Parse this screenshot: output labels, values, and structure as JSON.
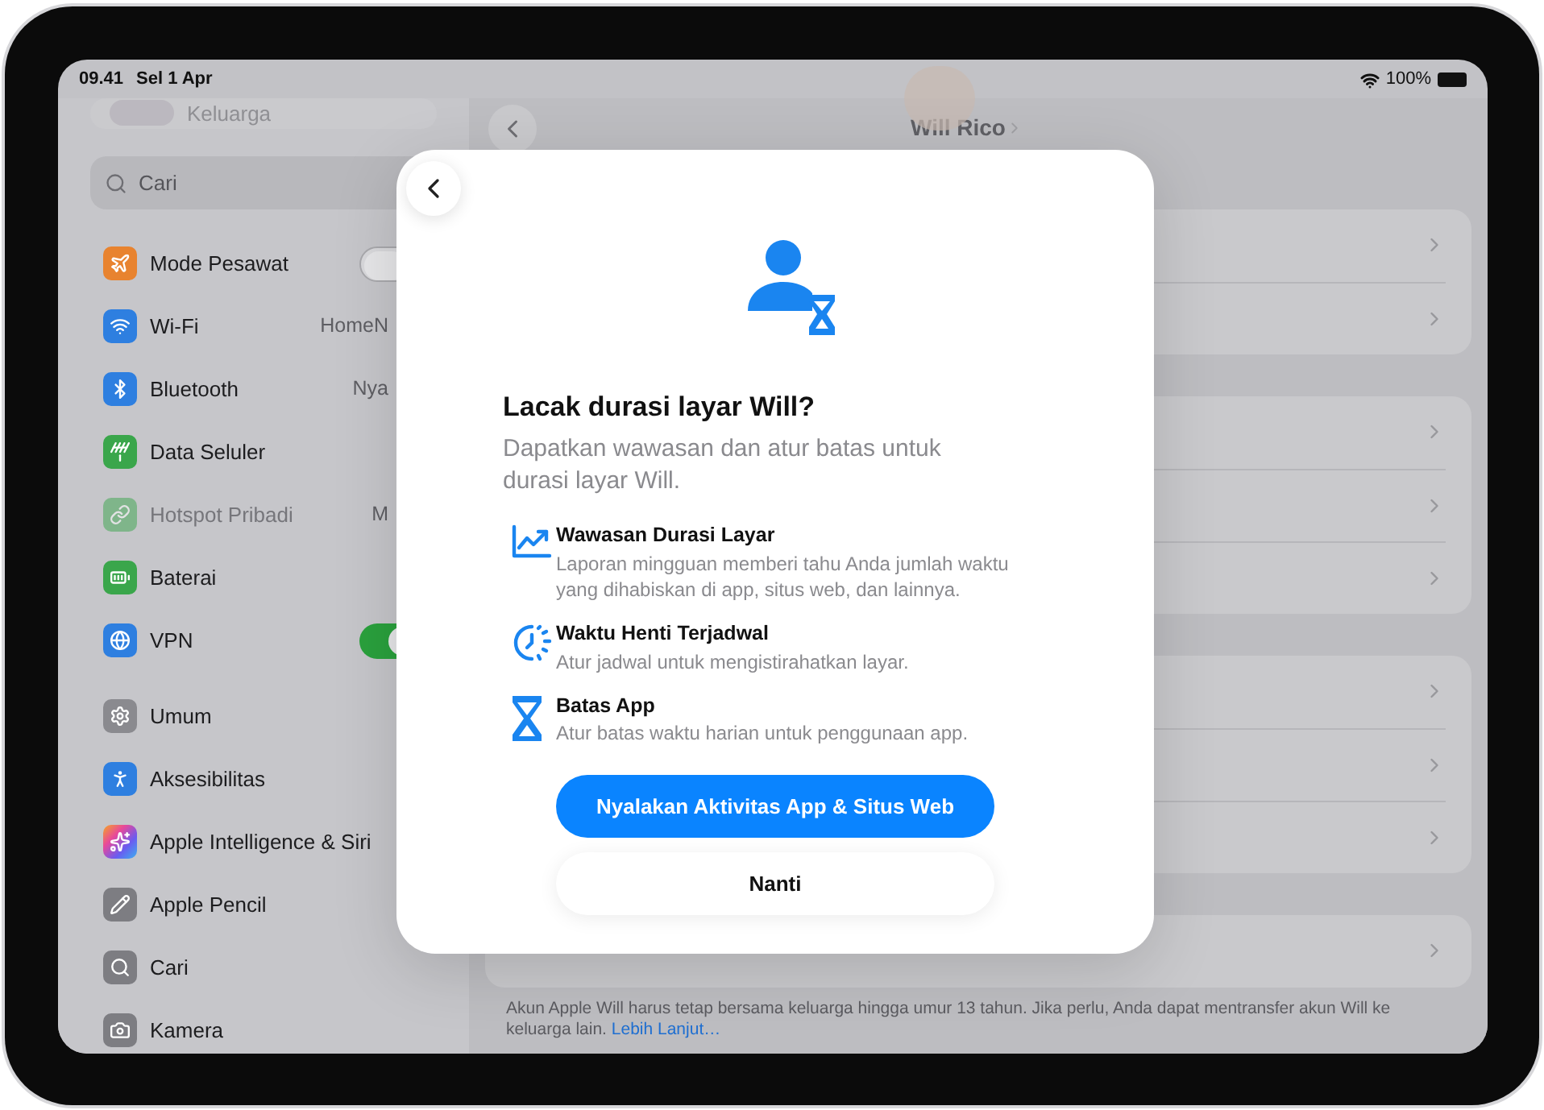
{
  "status_bar": {
    "time": "09.41",
    "date": "Sel 1 Apr",
    "battery": "100%"
  },
  "sidebar": {
    "family": "Keluarga",
    "search": {
      "placeholder": "Cari"
    },
    "groups": [
      [
        {
          "label": "Mode Pesawat",
          "kind": "toggle",
          "on": false,
          "disabled": false
        },
        {
          "label": "Wi-Fi",
          "kind": "value",
          "value": "HomeN",
          "disabled": false
        },
        {
          "label": "Bluetooth",
          "kind": "value",
          "value": "Nya",
          "disabled": false
        },
        {
          "label": "Data Seluler",
          "kind": "plain",
          "disabled": false
        },
        {
          "label": "Hotspot Pribadi",
          "kind": "value",
          "value": "M",
          "disabled": true
        },
        {
          "label": "Baterai",
          "kind": "plain",
          "disabled": false
        },
        {
          "label": "VPN",
          "kind": "toggle",
          "on": true,
          "disabled": false
        }
      ],
      [
        {
          "label": "Umum",
          "kind": "plain",
          "disabled": false
        },
        {
          "label": "Aksesibilitas",
          "kind": "plain",
          "disabled": false
        },
        {
          "label": "Apple Intelligence & Siri",
          "kind": "plain",
          "disabled": false
        },
        {
          "label": "Apple Pencil",
          "kind": "plain",
          "disabled": false
        },
        {
          "label": "Cari",
          "kind": "plain",
          "disabled": false
        },
        {
          "label": "Kamera",
          "kind": "plain",
          "disabled": false
        }
      ]
    ]
  },
  "detail": {
    "title": "Will Rico",
    "footer": "Akun Apple Will harus tetap bersama keluarga hingga umur 13 tahun. Jika perlu, Anda dapat mentransfer akun Will ke keluarga lain.",
    "footer_link": "Lebih Lanjut…"
  },
  "modal": {
    "title": "Lacak durasi layar Will?",
    "subtitle": "Dapatkan wawasan dan atur batas untuk durasi layar Will.",
    "features": [
      {
        "kind": "chart",
        "title": "Wawasan Durasi Layar",
        "text": "Laporan mingguan memberi tahu Anda jumlah waktu yang dihabiskan di app, situs web, dan lainnya."
      },
      {
        "kind": "downtime",
        "title": "Waktu Henti Terjadwal",
        "text": "Atur jadwal untuk mengistirahatkan layar."
      },
      {
        "kind": "limit",
        "title": "Batas App",
        "text": "Atur batas waktu harian untuk penggunaan app."
      }
    ],
    "primary_button": "Nyalakan Aktivitas App & Situs Web",
    "secondary_button": "Nanti"
  }
}
